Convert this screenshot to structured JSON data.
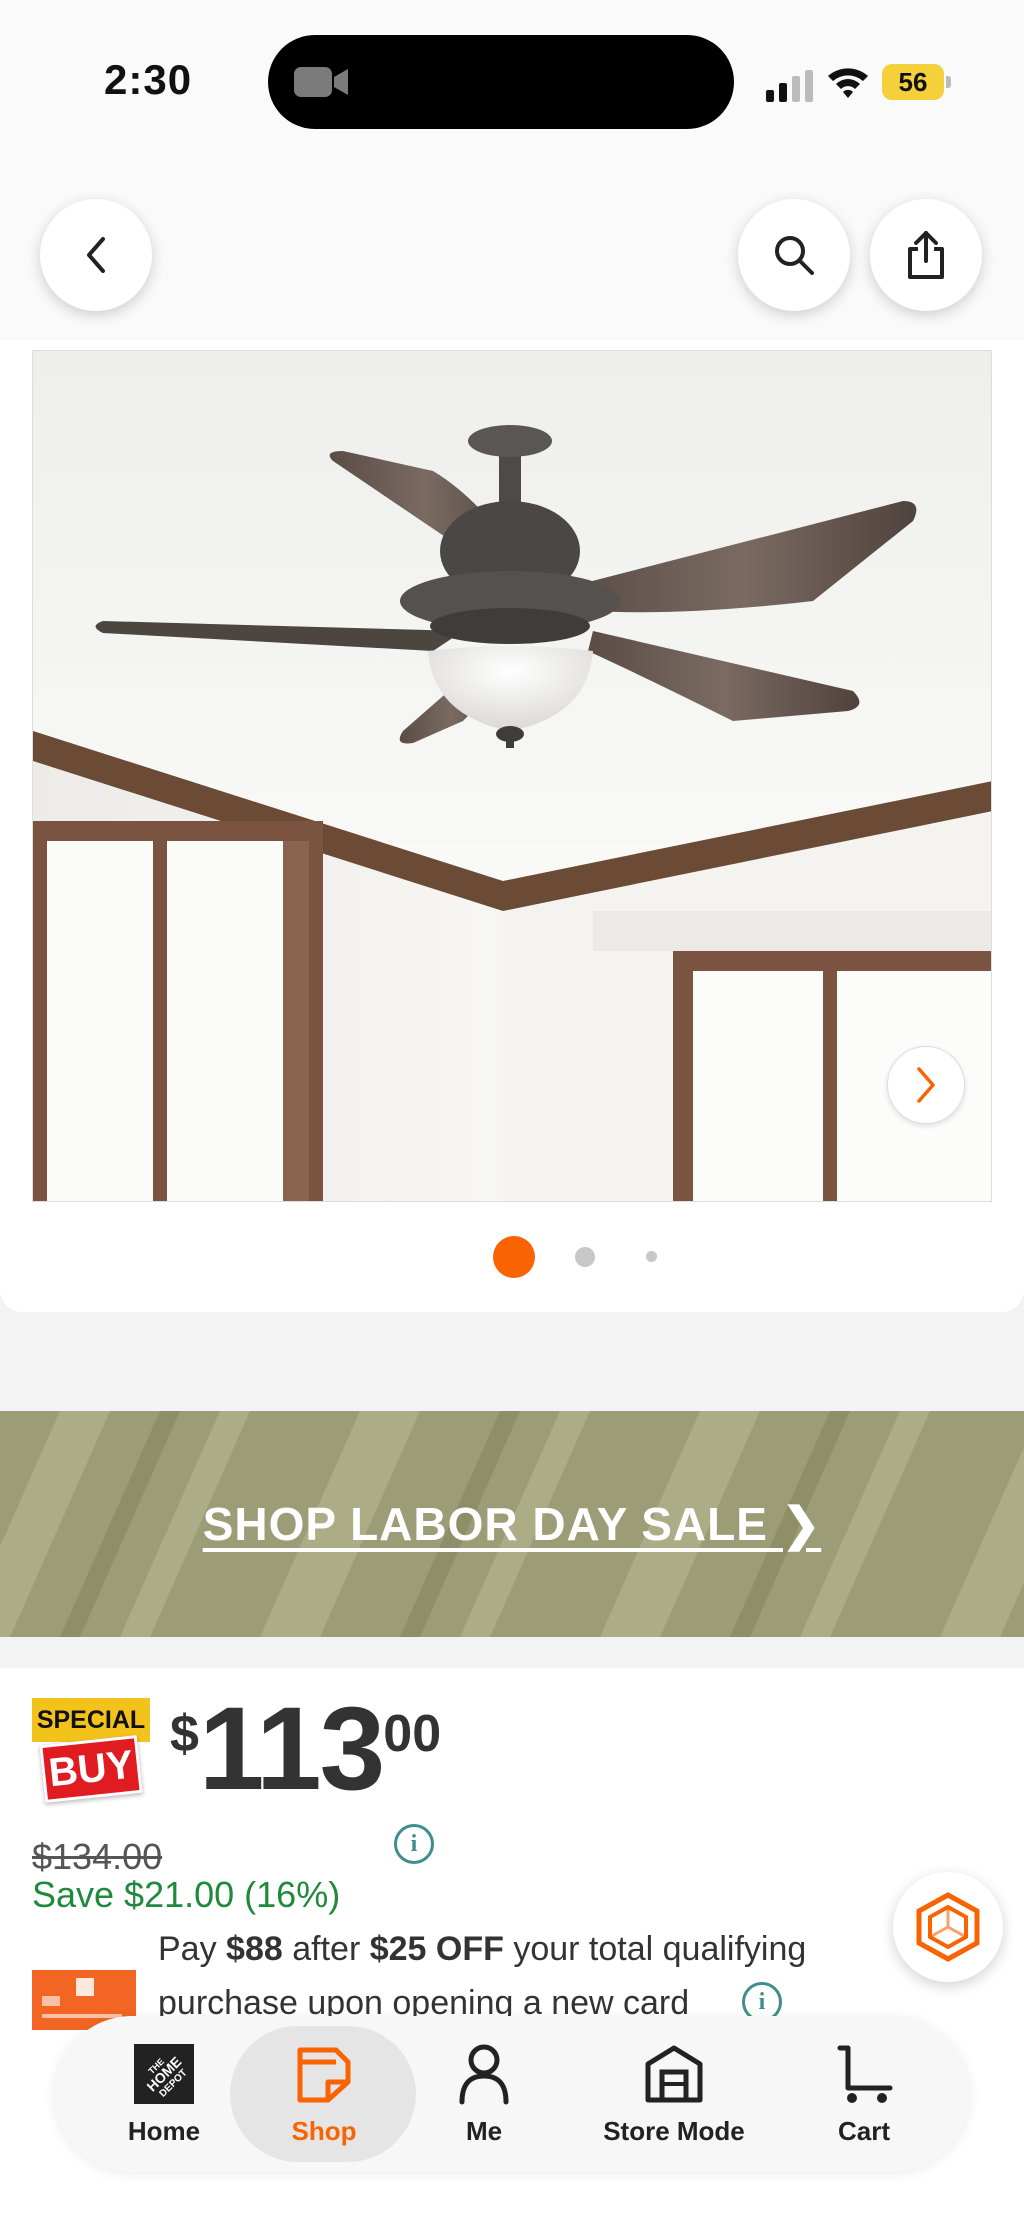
{
  "status_bar": {
    "time": "2:30",
    "battery": "56"
  },
  "header": {
    "back": "back-icon",
    "search": "search-icon",
    "share": "share-icon"
  },
  "gallery": {
    "current_index": 1,
    "total": 3
  },
  "banner": {
    "text": "SHOP LABOR DAY SALE ❯"
  },
  "badge": {
    "top": "SPECIAL",
    "bottom": "BUY"
  },
  "price": {
    "currency": "$",
    "dollars": "113",
    "cents": "00",
    "was": "$134.00",
    "save": "Save $21.00 (16%)"
  },
  "promo": {
    "pre": "Pay ",
    "amount": "$88",
    "mid": " after ",
    "off": "$25 OFF",
    "post": " your total qualifying purchase upon opening a new card"
  },
  "tabs": [
    {
      "label": "Home",
      "icon": "home-depot-logo-icon"
    },
    {
      "label": "Shop",
      "icon": "shop-icon",
      "active": true
    },
    {
      "label": "Me",
      "icon": "person-icon"
    },
    {
      "label": "Store Mode",
      "icon": "store-icon"
    },
    {
      "label": "Cart",
      "icon": "cart-icon"
    }
  ],
  "colors": {
    "accent": "#f96302",
    "save_green": "#1f8a3c",
    "info_teal": "#3e8e8e",
    "banner": "#9c9c76"
  }
}
